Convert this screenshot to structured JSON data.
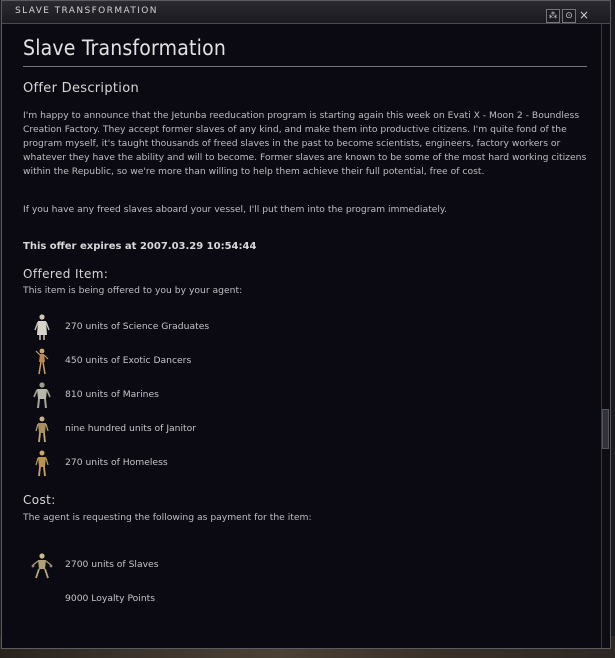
{
  "window": {
    "title": "SLAVE TRANSFORMATION",
    "buttons": {
      "settings": "⁂",
      "minimize": "⊙",
      "close": "×"
    }
  },
  "main": {
    "heading": "Slave Transformation",
    "offer_description_label": "Offer Description",
    "paragraph1": "I'm happy to announce that the Jetunba reeducation program is starting again this week on Evati X - Moon 2 - Boundless Creation Factory. They accept former slaves of any kind, and make them into productive citizens. I'm quite fond of the program myself, it's taught thousands of freed slaves in the past to become scientists, engineers, factory workers or whatever they have the ability and will to become. Former slaves are known to be some of the most hard working citizens within the Republic, so we're more than willing to help them achieve their full potential, free of cost.",
    "paragraph2": "If you have any freed slaves aboard your vessel, I'll put them into the program immediately.",
    "expires": "This offer expires at 2007.03.29 10:54:44",
    "offered_label": "Offered Item:",
    "offered_sub": "This item is being offered to you by your agent:",
    "offered_items": [
      {
        "label": "270 units of Science Graduates",
        "icon": "science-graduate-icon"
      },
      {
        "label": "450 units of Exotic Dancers",
        "icon": "exotic-dancer-icon"
      },
      {
        "label": "810 units of Marines",
        "icon": "marine-icon"
      },
      {
        "label": "nine hundred units of Janitor",
        "icon": "janitor-icon"
      },
      {
        "label": "270 units of Homeless",
        "icon": "homeless-icon"
      }
    ],
    "cost_label": "Cost:",
    "cost_sub": "The agent is requesting the following as payment for the item:",
    "cost_items": [
      {
        "label": "2700 units of Slaves",
        "icon": "slaves-icon"
      },
      {
        "label": "9000 Loyalty Points",
        "icon": ""
      }
    ]
  }
}
